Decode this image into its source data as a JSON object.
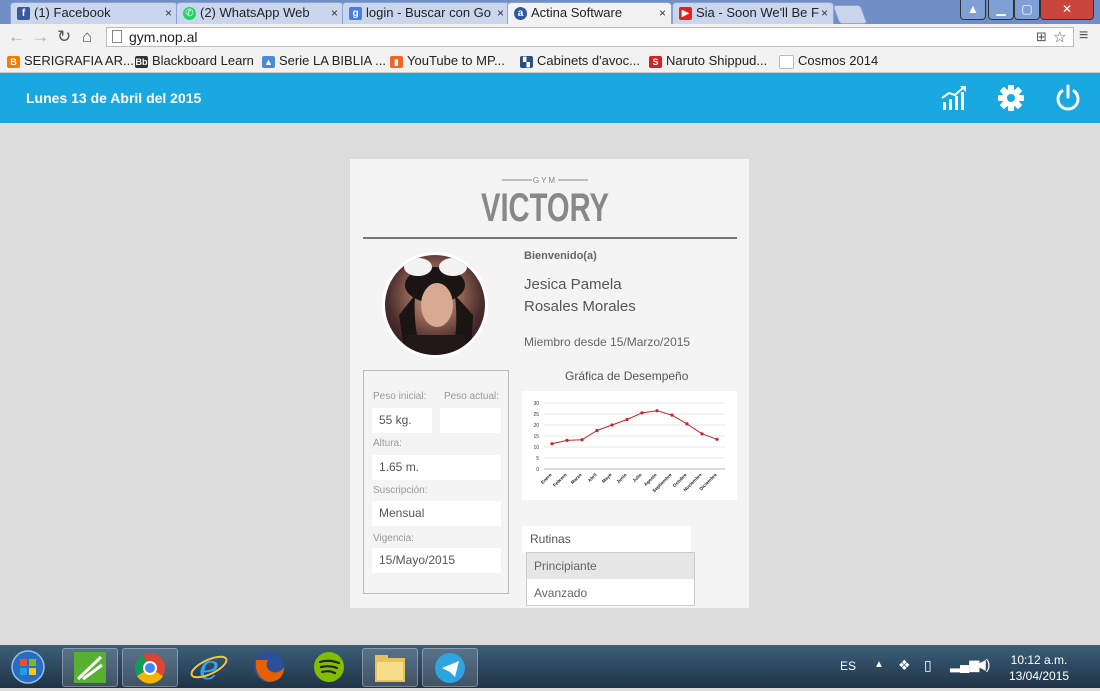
{
  "browser": {
    "tabs": [
      {
        "title": "(1) Facebook",
        "icon": "facebook-icon",
        "color": "#3b5998"
      },
      {
        "title": "(2) WhatsApp Web",
        "icon": "whatsapp-icon",
        "color": "#25d366"
      },
      {
        "title": "login - Buscar con Go",
        "icon": "google-icon",
        "color": "#4a7de2"
      },
      {
        "title": "Actina Software",
        "icon": "actina-icon",
        "color": "#2c5aa0"
      },
      {
        "title": "Sia - Soon We'll Be F",
        "icon": "youtube-icon",
        "color": "#e62117"
      }
    ],
    "url": "gym.nop.al",
    "bookmarks": [
      {
        "label": "SERIGRAFIA AR...",
        "icon": "blogger-icon",
        "color": "#f57d00"
      },
      {
        "label": "Blackboard Learn",
        "icon": "blackboard-icon",
        "color": "#333333"
      },
      {
        "label": "Serie LA BIBLIA ...",
        "icon": "image-icon",
        "color": "#4a8ad8"
      },
      {
        "label": "YouTube to MP...",
        "icon": "youtube-mp3-icon",
        "color": "#f26522"
      },
      {
        "label": "Cabinets d'avoc...",
        "icon": "cabinet-icon",
        "color": "#2b4f7f"
      },
      {
        "label": "Naruto Shippud...",
        "icon": "s-icon",
        "color": "#d32020"
      },
      {
        "label": "Cosmos 2014",
        "icon": "page-icon",
        "color": "#bbbbbb"
      }
    ]
  },
  "header": {
    "date": "Lunes 13 de Abril del 2015",
    "color": "#1aa8e0"
  },
  "logo": {
    "small": "GYM",
    "brand": "VICTORY"
  },
  "profile": {
    "welcome": "Bienvenido(a)",
    "name_line1": "Jesica Pamela",
    "name_line2": "Rosales Morales",
    "member_since": "Miembro desde 15/Marzo/2015",
    "chart_title": "Gráfica de Desempeño"
  },
  "info": {
    "peso_inicial_label": "Peso inicial:",
    "peso_actual_label": "Peso actual:",
    "peso_inicial": "55 kg.",
    "peso_actual": "",
    "altura_label": "Altura:",
    "altura": "1.65 m.",
    "suscripcion_label": "Suscripción:",
    "suscripcion": "Mensual",
    "vigencia_label": "Vigencia:",
    "vigencia": "15/Mayo/2015"
  },
  "rutinas": {
    "label": "Rutinas",
    "options": [
      "Principiante",
      "Avanzado"
    ],
    "highlighted": "Principiante"
  },
  "chart_data": {
    "type": "line",
    "categories": [
      "Enero",
      "Febrero",
      "Marzo",
      "Abril",
      "Mayo",
      "Junio",
      "Julio",
      "Agosto",
      "Septiembre",
      "Octubre",
      "Noviembre",
      "Diciembre"
    ],
    "series": [
      {
        "values": [
          11.5,
          13,
          13.3,
          17.5,
          20,
          22.5,
          25.5,
          26.5,
          24.5,
          20.5,
          16,
          13.5
        ],
        "color": "#c0272d"
      }
    ],
    "yticks": [
      "0",
      "5",
      "10",
      "15",
      "20",
      "25",
      "30"
    ],
    "ylim": [
      0,
      30
    ],
    "grid": true
  },
  "taskbar": {
    "lang": "ES",
    "time": "10:12 a.m.",
    "date": "13/04/2015",
    "apps": [
      "windows-start-icon",
      "greenshot-icon",
      "chrome-icon",
      "internet-explorer-icon",
      "firefox-icon",
      "spotify-icon",
      "file-explorer-icon",
      "telegram-icon"
    ]
  }
}
